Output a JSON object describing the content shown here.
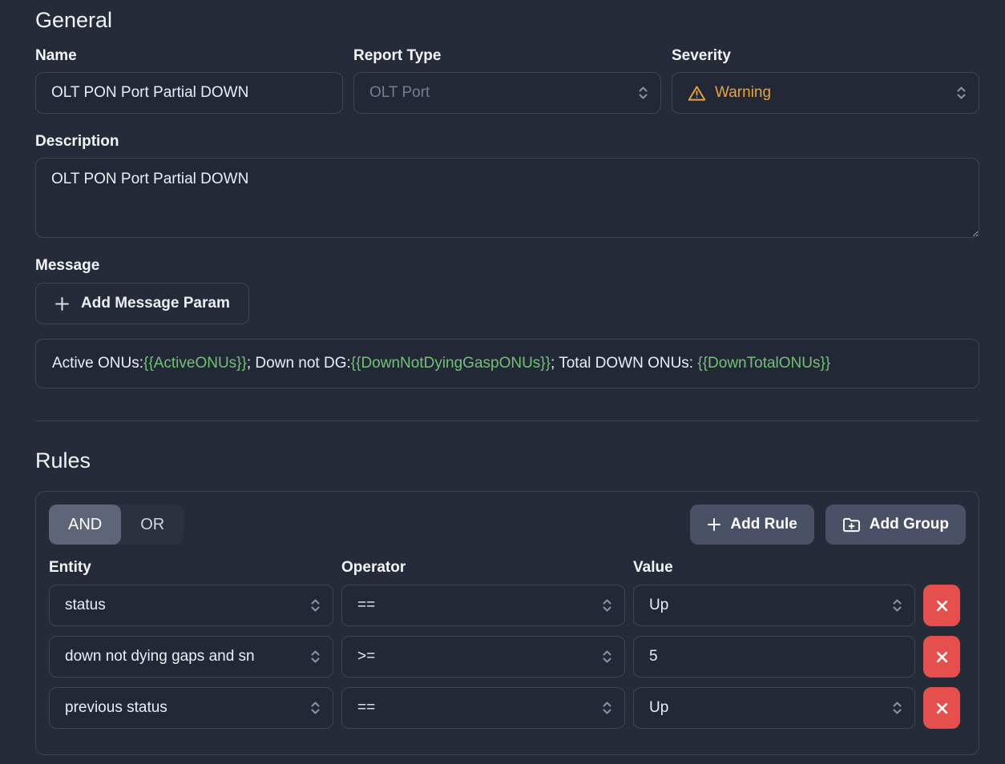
{
  "general": {
    "section_title": "General",
    "name": {
      "label": "Name",
      "value": "OLT PON Port Partial DOWN"
    },
    "report_type": {
      "label": "Report Type",
      "value": "OLT Port"
    },
    "severity": {
      "label": "Severity",
      "value": "Warning"
    },
    "description": {
      "label": "Description",
      "value": "OLT PON Port Partial DOWN"
    },
    "message": {
      "label": "Message",
      "add_param_button": "Add Message Param",
      "template_parts": [
        {
          "type": "plain",
          "text": "Active ONUs:"
        },
        {
          "type": "param",
          "text": "{{ActiveONUs}}"
        },
        {
          "type": "plain",
          "text": "; Down not DG:"
        },
        {
          "type": "param",
          "text": "{{DownNotDyingGaspONUs}}"
        },
        {
          "type": "plain",
          "text": "; Total DOWN ONUs: "
        },
        {
          "type": "param",
          "text": "{{DownTotalONUs}}"
        }
      ]
    }
  },
  "rules": {
    "section_title": "Rules",
    "logic_operator": {
      "options": [
        "AND",
        "OR"
      ],
      "selected": "AND"
    },
    "add_rule_button": "Add Rule",
    "add_group_button": "Add Group",
    "column_headers": {
      "entity": "Entity",
      "operator": "Operator",
      "value": "Value"
    },
    "rows": [
      {
        "entity": "status",
        "operator": "==",
        "value": "Up",
        "value_control": "select"
      },
      {
        "entity": "down not dying gaps and sn",
        "operator": ">=",
        "value": "5",
        "value_control": "input"
      },
      {
        "entity": "previous status",
        "operator": "==",
        "value": "Up",
        "value_control": "select"
      }
    ]
  },
  "colors": {
    "background": "#262b39",
    "input_background": "#232836",
    "border": "#3e4557",
    "text": "#eceef4",
    "muted_text": "#757d91",
    "warning": "#e8a33d",
    "param_green": "#73c176",
    "danger": "#e5504f",
    "button_gray": "#4a5166",
    "segment_selected": "#5e6579"
  }
}
